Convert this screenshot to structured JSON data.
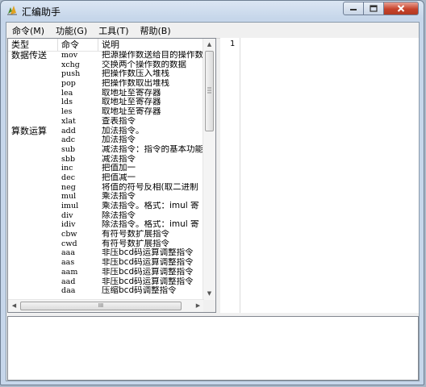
{
  "window": {
    "title": "汇编助手"
  },
  "menu": [
    {
      "label": "命令(M)"
    },
    {
      "label": "功能(G)"
    },
    {
      "label": "工具(T)"
    },
    {
      "label": "帮助(B)"
    }
  ],
  "table": {
    "headers": [
      "类型",
      "命令",
      "说明"
    ],
    "rows": [
      {
        "type": "数据传送",
        "cmd": "mov",
        "desc": "把源操作数送给目的操作数"
      },
      {
        "type": "",
        "cmd": "xchg",
        "desc": "交换两个操作数的数据"
      },
      {
        "type": "",
        "cmd": "push",
        "desc": "把操作数压入堆栈"
      },
      {
        "type": "",
        "cmd": "pop",
        "desc": "把操作数取出堆栈"
      },
      {
        "type": "",
        "cmd": "lea",
        "desc": "取地址至寄存器"
      },
      {
        "type": "",
        "cmd": "lds",
        "desc": "取地址至寄存器"
      },
      {
        "type": "",
        "cmd": "les",
        "desc": "取地址至寄存器"
      },
      {
        "type": "",
        "cmd": "xlat",
        "desc": "查表指令"
      },
      {
        "type": "算数运算",
        "cmd": "add",
        "desc": "加法指令。"
      },
      {
        "type": "",
        "cmd": "adc",
        "desc": "加法指令"
      },
      {
        "type": "",
        "cmd": "sub",
        "desc": "减法指令：指令的基本功能"
      },
      {
        "type": "",
        "cmd": "sbb",
        "desc": "减法指令"
      },
      {
        "type": "",
        "cmd": "inc",
        "desc": "把值加一"
      },
      {
        "type": "",
        "cmd": "dec",
        "desc": "把值减一"
      },
      {
        "type": "",
        "cmd": "neg",
        "desc": "将值的符号反相(取二进制"
      },
      {
        "type": "",
        "cmd": "mul",
        "desc": "乘法指令"
      },
      {
        "type": "",
        "cmd": "imul",
        "desc": "乘法指令。格式：imul 寄"
      },
      {
        "type": "",
        "cmd": "div",
        "desc": "除法指令"
      },
      {
        "type": "",
        "cmd": "idiv",
        "desc": "除法指令。格式：imul 寄"
      },
      {
        "type": "",
        "cmd": "cbw",
        "desc": "有符号数扩展指令"
      },
      {
        "type": "",
        "cmd": "cwd",
        "desc": "有符号数扩展指令"
      },
      {
        "type": "",
        "cmd": "aaa",
        "desc": "非压bcd码运算调整指令"
      },
      {
        "type": "",
        "cmd": "aas",
        "desc": "非压bcd码运算调整指令"
      },
      {
        "type": "",
        "cmd": "aam",
        "desc": "非压bcd码运算调整指令"
      },
      {
        "type": "",
        "cmd": "aad",
        "desc": "非压bcd码运算调整指令"
      },
      {
        "type": "",
        "cmd": "daa",
        "desc": "压缩bcd码调整指令"
      }
    ]
  },
  "editor": {
    "line_number": "1"
  },
  "scrollbar": {
    "grip": "III"
  }
}
